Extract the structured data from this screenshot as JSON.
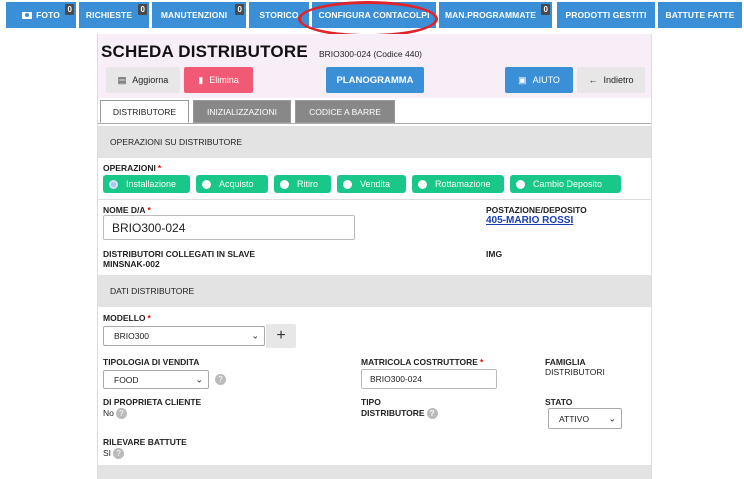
{
  "nav": {
    "items": [
      {
        "label": "FOTO",
        "badge": "0"
      },
      {
        "label": "RICHIESTE",
        "badge": "0"
      },
      {
        "label": "MANUTENZIONI",
        "badge": "0"
      },
      {
        "label": "STORICO",
        "badge": ""
      },
      {
        "label": "CONFIGURA CONTACOLPI",
        "badge": ""
      },
      {
        "label": "MAN.PROGRAMMATE",
        "badge": "0"
      },
      {
        "label": "PRODOTTI GESTITI",
        "badge": ""
      },
      {
        "label": "BATTUTE FATTE",
        "badge": ""
      }
    ]
  },
  "header": {
    "title": "SCHEDA DISTRIBUTORE",
    "subtitle": "BRIO300-024 (Codice 440)"
  },
  "toolbar": {
    "save_label": "Aggiorna",
    "delete_label": "Elimina",
    "planogram_label": "PLANOGRAMMA",
    "help_label": "AIUTO",
    "back_label": "Indietro"
  },
  "tabs": [
    "DISTRIBUTORE",
    "INIZIALIZZAZIONI",
    "CODICE A BARRE"
  ],
  "operations": {
    "section_title": "OPERAZIONI SU DISTRIBUTORE",
    "label": "OPERAZIONI",
    "options": [
      "Installazione",
      "Acquisto",
      "Ritiro",
      "Vendita",
      "Rottamazione",
      "Cambio Deposito"
    ],
    "selected": "Installazione"
  },
  "identity": {
    "name_label": "NOME D/A",
    "name_value": "BRIO300-024",
    "location_label": "POSTAZIONE/DEPOSITO",
    "location_value": "405-MARIO ROSSI",
    "slave_label": "DISTRIBUTORI COLLEGATI IN SLAVE",
    "slave_value": "MINSNAK-002",
    "img_label": "IMG"
  },
  "details": {
    "section_title": "DATI DISTRIBUTORE",
    "model_label": "MODELLO",
    "model_value": "BRIO300",
    "sale_type_label": "TIPOLOGIA DI VENDITA",
    "sale_type_value": "FOOD",
    "serial_label": "MATRICOLA COSTRUTTORE",
    "serial_value": "BRIO300-024",
    "family_label": "FAMIGLIA",
    "family_value": "DISTRIBUTORI",
    "owned_label": "DI PROPRIETA CLIENTE",
    "owned_value": "No",
    "type_label_1": "TIPO",
    "type_label_2": "DISTRIBUTORE",
    "status_label": "STATO",
    "status_value": "ATTIVO",
    "counts_label": "RILEVARE BATTUTE",
    "counts_value": "SI"
  },
  "colors": {
    "primary": "#3a8fd6",
    "danger": "#f05a74",
    "success": "#19c789",
    "highlight": "#e0242b"
  }
}
